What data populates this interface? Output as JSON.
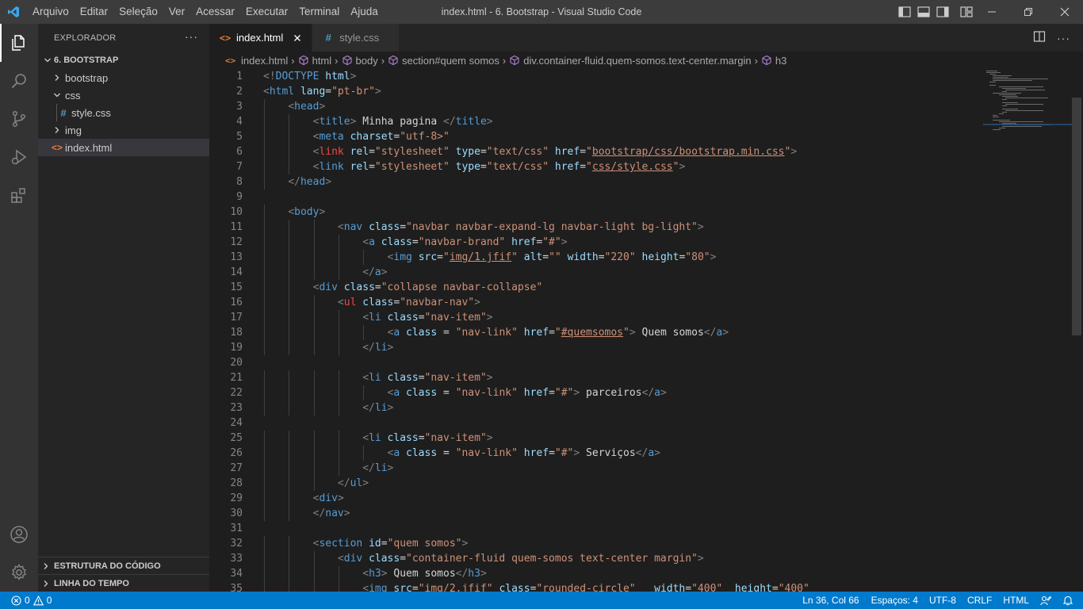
{
  "titlebar": {
    "menus": [
      "Arquivo",
      "Editar",
      "Seleção",
      "Ver",
      "Acessar",
      "Executar",
      "Terminal",
      "Ajuda"
    ],
    "window_title": "index.html - 6. Bootstrap - Visual Studio Code",
    "icons": [
      "vscode-logo-icon",
      "toggle-primary-sidebar-icon",
      "toggle-panel-icon",
      "toggle-secondary-sidebar-icon",
      "customize-layout-icon",
      "minimize-icon",
      "restore-icon",
      "close-icon"
    ]
  },
  "activitybar": {
    "icons": [
      "explorer-icon",
      "search-icon",
      "source-control-icon",
      "run-debug-icon",
      "extensions-icon",
      "account-icon",
      "manage-gear-icon"
    ]
  },
  "sidebar": {
    "header": "EXPLORADOR",
    "more": "···",
    "root": "6. BOOTSTRAP",
    "items": [
      {
        "label": "bootstrap",
        "type": "folder",
        "expanded": false
      },
      {
        "label": "css",
        "type": "folder",
        "expanded": true
      },
      {
        "label": "style.css",
        "type": "css"
      },
      {
        "label": "img",
        "type": "folder",
        "expanded": false
      },
      {
        "label": "index.html",
        "type": "html"
      }
    ],
    "sections": [
      "ESTRUTURA DO CÓDIGO",
      "LINHA DO TEMPO"
    ]
  },
  "tabs": [
    {
      "label": "index.html",
      "active": true,
      "icon": "<>"
    },
    {
      "label": "style.css",
      "active": false,
      "icon": "#"
    }
  ],
  "breadcrumbs": [
    "index.html",
    "html",
    "body",
    "section#quem somos",
    "div.container-fluid.quem-somos.text-center.margin",
    "h3"
  ],
  "code_lines": [
    {
      "n": "1",
      "indent": 0,
      "parts": [
        [
          "t",
          "<!"
        ],
        [
          "tn",
          "DOCTYPE"
        ],
        [
          "tx",
          " "
        ],
        [
          "an",
          "html"
        ],
        [
          "t",
          ">"
        ]
      ]
    },
    {
      "n": "2",
      "indent": 0,
      "parts": [
        [
          "t",
          "<"
        ],
        [
          "tn",
          "html"
        ],
        [
          "tx",
          " "
        ],
        [
          "an",
          "lang"
        ],
        [
          "tx",
          "="
        ],
        [
          "av",
          "\"pt-br\""
        ],
        [
          "t",
          ">"
        ]
      ]
    },
    {
      "n": "3",
      "indent": 4,
      "parts": [
        [
          "t",
          "<"
        ],
        [
          "tn",
          "head"
        ],
        [
          "t",
          ">"
        ]
      ]
    },
    {
      "n": "4",
      "indent": 8,
      "parts": [
        [
          "t",
          "<"
        ],
        [
          "tn",
          "title"
        ],
        [
          "t",
          ">"
        ],
        [
          "tx",
          " Minha pagina "
        ],
        [
          "t",
          "</"
        ],
        [
          "tn",
          "title"
        ],
        [
          "t",
          ">"
        ]
      ]
    },
    {
      "n": "5",
      "indent": 8,
      "parts": [
        [
          "t",
          "<"
        ],
        [
          "tn",
          "meta"
        ],
        [
          "tx",
          " "
        ],
        [
          "an",
          "charset"
        ],
        [
          "tx",
          "="
        ],
        [
          "av",
          "\"utf-8>\""
        ]
      ]
    },
    {
      "n": "6",
      "indent": 8,
      "parts": [
        [
          "t",
          "<"
        ],
        [
          "tn",
          "link"
        ],
        [
          "tx",
          " "
        ],
        [
          "an",
          "rel"
        ],
        [
          "tx",
          "="
        ],
        [
          "av",
          "\"stylesheet\""
        ],
        [
          "tx",
          " "
        ],
        [
          "an",
          "type"
        ],
        [
          "tx",
          "="
        ],
        [
          "av",
          "\"text/css\""
        ],
        [
          "tx",
          " "
        ],
        [
          "an",
          "href"
        ],
        [
          "tx",
          "="
        ],
        [
          "av",
          "\""
        ],
        [
          "avu",
          "bootstrap/css/bootstrap.min.css"
        ],
        [
          "av",
          "\""
        ],
        [
          "t",
          ">"
        ]
      ]
    },
    {
      "n": "7",
      "indent": 8,
      "parts": [
        [
          "t",
          "<"
        ],
        [
          "tn",
          "link"
        ],
        [
          "tx",
          " "
        ],
        [
          "an",
          "rel"
        ],
        [
          "tx",
          "="
        ],
        [
          "av",
          "\"stylesheet\""
        ],
        [
          "tx",
          " "
        ],
        [
          "an",
          "type"
        ],
        [
          "tx",
          "="
        ],
        [
          "av",
          "\"text/css\""
        ],
        [
          "tx",
          " "
        ],
        [
          "an",
          "href"
        ],
        [
          "tx",
          "="
        ],
        [
          "av",
          "\""
        ],
        [
          "avu",
          "css/style.css"
        ],
        [
          "av",
          "\""
        ],
        [
          "t",
          ">"
        ]
      ]
    },
    {
      "n": "8",
      "indent": 4,
      "parts": [
        [
          "t",
          "</"
        ],
        [
          "tn",
          "head"
        ],
        [
          "t",
          ">"
        ]
      ]
    },
    {
      "n": "9",
      "indent": 0,
      "parts": []
    },
    {
      "n": "10",
      "indent": 4,
      "parts": [
        [
          "t",
          "<"
        ],
        [
          "tn",
          "body"
        ],
        [
          "t",
          ">"
        ]
      ]
    },
    {
      "n": "11",
      "indent": 12,
      "parts": [
        [
          "t",
          "<"
        ],
        [
          "tn",
          "nav"
        ],
        [
          "tx",
          " "
        ],
        [
          "an",
          "class"
        ],
        [
          "tx",
          "="
        ],
        [
          "av",
          "\"navbar navbar-expand-lg navbar-light bg-light\""
        ],
        [
          "t",
          ">"
        ]
      ]
    },
    {
      "n": "12",
      "indent": 16,
      "parts": [
        [
          "t",
          "<"
        ],
        [
          "tn",
          "a"
        ],
        [
          "tx",
          " "
        ],
        [
          "an",
          "class"
        ],
        [
          "tx",
          "="
        ],
        [
          "av",
          "\"navbar-brand\""
        ],
        [
          "tx",
          " "
        ],
        [
          "an",
          "href"
        ],
        [
          "tx",
          "="
        ],
        [
          "av",
          "\"#\""
        ],
        [
          "t",
          ">"
        ]
      ]
    },
    {
      "n": "13",
      "indent": 20,
      "parts": [
        [
          "t",
          "<"
        ],
        [
          "tn",
          "img"
        ],
        [
          "tx",
          " "
        ],
        [
          "an",
          "src"
        ],
        [
          "tx",
          "="
        ],
        [
          "av",
          "\""
        ],
        [
          "avu",
          "img/1.jfif"
        ],
        [
          "av",
          "\""
        ],
        [
          "tx",
          " "
        ],
        [
          "an",
          "alt"
        ],
        [
          "tx",
          "="
        ],
        [
          "av",
          "\"\""
        ],
        [
          "tx",
          " "
        ],
        [
          "an",
          "width"
        ],
        [
          "tx",
          "="
        ],
        [
          "av",
          "\"220\""
        ],
        [
          "tx",
          " "
        ],
        [
          "an",
          "height"
        ],
        [
          "tx",
          "="
        ],
        [
          "av",
          "\"80\""
        ],
        [
          "t",
          ">"
        ]
      ]
    },
    {
      "n": "14",
      "indent": 16,
      "parts": [
        [
          "t",
          "</"
        ],
        [
          "tn",
          "a"
        ],
        [
          "t",
          ">"
        ]
      ]
    },
    {
      "n": "15",
      "indent": 8,
      "parts": [
        [
          "t",
          "<"
        ],
        [
          "tn",
          "div"
        ],
        [
          "tx",
          " "
        ],
        [
          "an",
          "class"
        ],
        [
          "tx",
          "="
        ],
        [
          "av",
          "\"collapse navbar-collapse\""
        ]
      ]
    },
    {
      "n": "16",
      "indent": 12,
      "parts": [
        [
          "t",
          "<"
        ],
        [
          "tn",
          "ul"
        ],
        [
          "tx",
          " "
        ],
        [
          "an",
          "class"
        ],
        [
          "tx",
          "="
        ],
        [
          "av",
          "\"navbar-nav\""
        ],
        [
          "t",
          ">"
        ]
      ]
    },
    {
      "n": "17",
      "indent": 16,
      "parts": [
        [
          "t",
          "<"
        ],
        [
          "tn",
          "li"
        ],
        [
          "tx",
          " "
        ],
        [
          "an",
          "class"
        ],
        [
          "tx",
          "="
        ],
        [
          "av",
          "\"nav-item\""
        ],
        [
          "t",
          ">"
        ]
      ]
    },
    {
      "n": "18",
      "indent": 20,
      "parts": [
        [
          "t",
          "<"
        ],
        [
          "tn",
          "a"
        ],
        [
          "tx",
          " "
        ],
        [
          "an",
          "class"
        ],
        [
          "tx",
          " = "
        ],
        [
          "av",
          "\"nav-link\""
        ],
        [
          "tx",
          " "
        ],
        [
          "an",
          "href"
        ],
        [
          "tx",
          "="
        ],
        [
          "av",
          "\""
        ],
        [
          "avu",
          "#quemsomos"
        ],
        [
          "av",
          "\""
        ],
        [
          "t",
          ">"
        ],
        [
          "tx",
          " Quem somos"
        ],
        [
          "t",
          "</"
        ],
        [
          "tn",
          "a"
        ],
        [
          "t",
          ">"
        ]
      ]
    },
    {
      "n": "19",
      "indent": 16,
      "parts": [
        [
          "t",
          "</"
        ],
        [
          "tn",
          "li"
        ],
        [
          "t",
          ">"
        ]
      ]
    },
    {
      "n": "20",
      "indent": 0,
      "parts": []
    },
    {
      "n": "21",
      "indent": 16,
      "parts": [
        [
          "t",
          "<"
        ],
        [
          "tn",
          "li"
        ],
        [
          "tx",
          " "
        ],
        [
          "an",
          "class"
        ],
        [
          "tx",
          "="
        ],
        [
          "av",
          "\"nav-item\""
        ],
        [
          "t",
          ">"
        ]
      ]
    },
    {
      "n": "22",
      "indent": 20,
      "parts": [
        [
          "t",
          "<"
        ],
        [
          "tn",
          "a"
        ],
        [
          "tx",
          " "
        ],
        [
          "an",
          "class"
        ],
        [
          "tx",
          " = "
        ],
        [
          "av",
          "\"nav-link\""
        ],
        [
          "tx",
          " "
        ],
        [
          "an",
          "href"
        ],
        [
          "tx",
          "="
        ],
        [
          "av",
          "\"#\""
        ],
        [
          "t",
          ">"
        ],
        [
          "tx",
          " parceiros"
        ],
        [
          "t",
          "</"
        ],
        [
          "tn",
          "a"
        ],
        [
          "t",
          ">"
        ]
      ]
    },
    {
      "n": "23",
      "indent": 16,
      "parts": [
        [
          "t",
          "</"
        ],
        [
          "tn",
          "li"
        ],
        [
          "t",
          ">"
        ]
      ]
    },
    {
      "n": "24",
      "indent": 0,
      "parts": []
    },
    {
      "n": "25",
      "indent": 16,
      "parts": [
        [
          "t",
          "<"
        ],
        [
          "tn",
          "li"
        ],
        [
          "tx",
          " "
        ],
        [
          "an",
          "class"
        ],
        [
          "tx",
          "="
        ],
        [
          "av",
          "\"nav-item\""
        ],
        [
          "t",
          ">"
        ]
      ]
    },
    {
      "n": "26",
      "indent": 20,
      "parts": [
        [
          "t",
          "<"
        ],
        [
          "tn",
          "a"
        ],
        [
          "tx",
          " "
        ],
        [
          "an",
          "class"
        ],
        [
          "tx",
          " = "
        ],
        [
          "av",
          "\"nav-link\""
        ],
        [
          "tx",
          " "
        ],
        [
          "an",
          "href"
        ],
        [
          "tx",
          "="
        ],
        [
          "av",
          "\"#\""
        ],
        [
          "t",
          ">"
        ],
        [
          "tx",
          " Serviços"
        ],
        [
          "t",
          "</"
        ],
        [
          "tn",
          "a"
        ],
        [
          "t",
          ">"
        ]
      ]
    },
    {
      "n": "27",
      "indent": 16,
      "parts": [
        [
          "t",
          "</"
        ],
        [
          "tn",
          "li"
        ],
        [
          "t",
          ">"
        ]
      ]
    },
    {
      "n": "28",
      "indent": 12,
      "parts": [
        [
          "t",
          "</"
        ],
        [
          "tn",
          "ul"
        ],
        [
          "t",
          ">"
        ]
      ]
    },
    {
      "n": "29",
      "indent": 8,
      "parts": [
        [
          "t",
          "<"
        ],
        [
          "tn",
          "div"
        ],
        [
          "t",
          ">"
        ]
      ]
    },
    {
      "n": "30",
      "indent": 8,
      "parts": [
        [
          "t",
          "</"
        ],
        [
          "tn",
          "nav"
        ],
        [
          "t",
          ">"
        ]
      ]
    },
    {
      "n": "31",
      "indent": 0,
      "parts": []
    },
    {
      "n": "32",
      "indent": 8,
      "parts": [
        [
          "t",
          "<"
        ],
        [
          "tn",
          "section"
        ],
        [
          "tx",
          " "
        ],
        [
          "an",
          "id"
        ],
        [
          "tx",
          "="
        ],
        [
          "av",
          "\"quem somos\""
        ],
        [
          "t",
          ">"
        ]
      ]
    },
    {
      "n": "33",
      "indent": 12,
      "parts": [
        [
          "t",
          "<"
        ],
        [
          "tn",
          "div"
        ],
        [
          "tx",
          " "
        ],
        [
          "an",
          "class"
        ],
        [
          "tx",
          "="
        ],
        [
          "av",
          "\"container-fluid quem-somos text-center margin\""
        ],
        [
          "t",
          ">"
        ]
      ]
    },
    {
      "n": "34",
      "indent": 16,
      "parts": [
        [
          "t",
          "<"
        ],
        [
          "tn",
          "h3"
        ],
        [
          "t",
          ">"
        ],
        [
          "tx",
          " Quem somos"
        ],
        [
          "t",
          "</"
        ],
        [
          "tn",
          "h3"
        ],
        [
          "t",
          ">"
        ]
      ]
    },
    {
      "n": "35",
      "indent": 16,
      "parts": [
        [
          "t",
          "<"
        ],
        [
          "tn",
          "img"
        ],
        [
          "tx",
          " "
        ],
        [
          "an",
          "src"
        ],
        [
          "tx",
          "="
        ],
        [
          "av",
          "\"img/2.jfif\""
        ],
        [
          "tx",
          " "
        ],
        [
          "an",
          "class"
        ],
        [
          "tx",
          "="
        ],
        [
          "av",
          "\"rounded-circle\""
        ],
        [
          "tx",
          "   "
        ],
        [
          "an",
          "width"
        ],
        [
          "tx",
          "="
        ],
        [
          "av",
          "\"400\""
        ],
        [
          "tx",
          "  "
        ],
        [
          "an",
          "height"
        ],
        [
          "tx",
          "="
        ],
        [
          "av",
          "\"400\""
        ]
      ]
    }
  ],
  "statusbar": {
    "errors": "0",
    "warnings": "0",
    "position": "Ln 36, Col 66",
    "spaces": "Espaços: 4",
    "encoding": "UTF-8",
    "eol": "CRLF",
    "language": "HTML"
  },
  "colors": {
    "statusbar": "#007acc",
    "tag": "#569cd6",
    "attr": "#9cdcfe",
    "string": "#ce9178",
    "error_tag": "#f44747"
  }
}
